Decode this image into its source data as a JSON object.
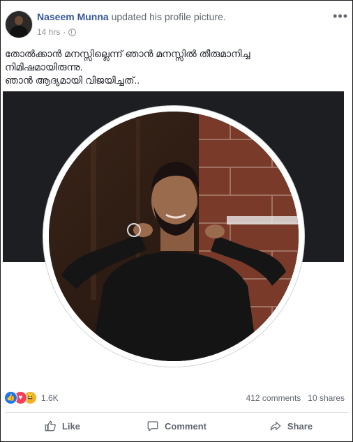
{
  "post": {
    "author": "Naseem Munna",
    "action_text": "updated his profile picture.",
    "time": "14 hrs",
    "privacy_icon": "globe-icon",
    "more_label": "•••",
    "text_lines": [
      "തോൽക്കാൻ മനസ്സില്ലെന്ന് ഞാൻ മനസ്സിൽ തീരുമാനിച്ച",
      "നിമിഷമായിരുന്നു.",
      "ഞാൻ ആദ്യമായി വിജയിച്ചത്.."
    ]
  },
  "reactions": {
    "icons": [
      "like-icon",
      "love-icon",
      "haha-icon"
    ],
    "count": "1.6K",
    "comments": "412 comments",
    "shares": "10 shares"
  },
  "actions": {
    "like": "Like",
    "comment": "Comment",
    "share": "Share"
  },
  "colors": {
    "link": "#385898",
    "like": "#1877f2",
    "love": "#f33e58",
    "haha": "#f7b125"
  }
}
